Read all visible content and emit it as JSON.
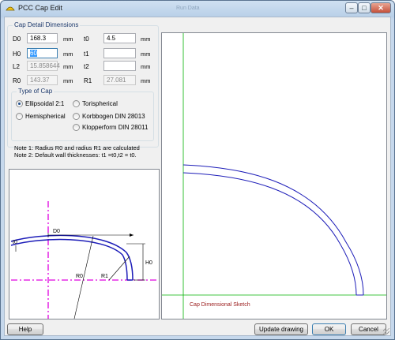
{
  "window": {
    "title": "PCC Cap Edit",
    "bg_title": "Run Data",
    "controls": {
      "minimize": "‒",
      "maximize": "□",
      "close": "✕"
    }
  },
  "cap_details": {
    "group_label": "Cap Detail Dimensions",
    "fields": {
      "D0": {
        "label": "D0",
        "value": "168.3",
        "unit": "mm"
      },
      "H0": {
        "label": "H0",
        "value": "60",
        "unit": "mm"
      },
      "L2": {
        "label": "L2",
        "value": "15.858644",
        "unit": "mm"
      },
      "R0": {
        "label": "R0",
        "value": "143.37",
        "unit": "mm"
      },
      "t0": {
        "label": "t0",
        "value": "4.5",
        "unit": "mm"
      },
      "t1": {
        "label": "t1",
        "value": "",
        "unit": "mm"
      },
      "t2": {
        "label": "t2",
        "value": "",
        "unit": "mm"
      },
      "R1": {
        "label": "R1",
        "value": "27.081",
        "unit": "mm"
      }
    }
  },
  "cap_type": {
    "group_label": "Type of Cap",
    "options": [
      {
        "label": "Ellipsoidal 2:1",
        "checked": true
      },
      {
        "label": "Hemispherical",
        "checked": false
      },
      {
        "label": "Torispherical",
        "checked": false
      },
      {
        "label": "Korbbogen DIN 28013",
        "checked": false
      },
      {
        "label": "Klopperform DIN 28011",
        "checked": false
      }
    ]
  },
  "notes": [
    "Note 1: Radius R0 and radius R1 are calculated",
    "Note 2: Default wall thicknesses: t1 =t0,t2 = t0."
  ],
  "reference_sketch": {
    "labels": {
      "D0": "D0",
      "t0": "t0",
      "H0": "H0",
      "R0": "R0",
      "R1": "R1"
    }
  },
  "sketch_caption": "Cap Dimensional Sketch",
  "buttons": {
    "help": "Help",
    "update": "Update drawing",
    "ok": "OK",
    "cancel": "Cancel"
  },
  "colors": {
    "outline_blue": "#1c1cb8",
    "centerline_magenta": "#e000e0",
    "axis_green": "#00b000",
    "caption_red": "#9a1a1a"
  }
}
